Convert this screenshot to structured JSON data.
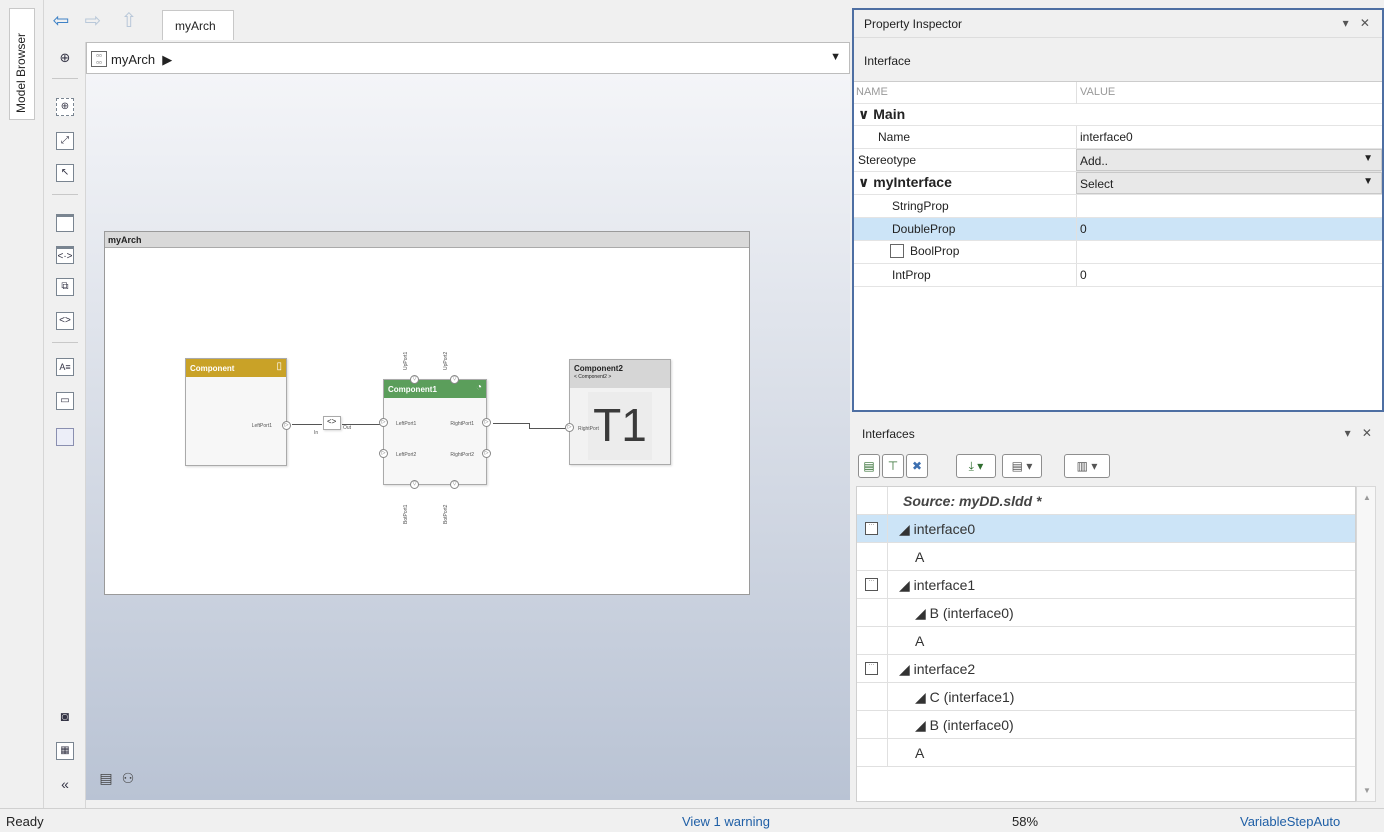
{
  "model_browser": {
    "label": "Model Browser"
  },
  "editor": {
    "tab_label": "myArch",
    "breadcrumb": "myArch",
    "canvas": {
      "architecture_title": "myArch",
      "component": {
        "name": "Component",
        "port_right": "LeftPort1"
      },
      "adapter": {
        "in_label": "In",
        "out_label": "Out"
      },
      "component1": {
        "name": "Component1",
        "ports_left": [
          "LeftPort1",
          "LeftPort2"
        ],
        "ports_right": [
          "RightPort1",
          "RightPort2"
        ],
        "ports_top": [
          "UpPort1",
          "UpPort2"
        ],
        "ports_bottom": [
          "BotPort1",
          "BotPort2"
        ]
      },
      "component2": {
        "name": "Component2",
        "subtitle": "< Component2 >",
        "port_left": "RightPort",
        "overlay_text": "T1"
      }
    }
  },
  "property_inspector": {
    "title": "Property Inspector",
    "pin_controls": "▾ ✕",
    "element_type": "Interface",
    "column_name": "NAME",
    "column_value": "VALUE",
    "sections": {
      "main": "Main",
      "my_interface": "myInterface"
    },
    "rows": {
      "name_label": "Name",
      "name_value": "interface0",
      "stereotype_label": "Stereotype",
      "stereotype_value": "Add..",
      "my_interface_value": "Select",
      "string_prop_label": "StringProp",
      "string_prop_value": "",
      "double_prop_label": "DoubleProp",
      "double_prop_value": "0",
      "bool_prop_label": "BoolProp",
      "int_prop_label": "IntProp",
      "int_prop_value": "0"
    }
  },
  "interfaces_pane": {
    "title": "Interfaces",
    "pin_controls": "▾ ✕",
    "source_header": "Source: myDD.sldd *",
    "items": [
      {
        "label": "◢ interface0",
        "depth": 0,
        "icon": true,
        "selected": true
      },
      {
        "label": "A",
        "depth": 1,
        "icon": false,
        "selected": false
      },
      {
        "label": "◢ interface1",
        "depth": 0,
        "icon": true,
        "selected": false
      },
      {
        "label": "◢ B (interface0)",
        "depth": 1,
        "icon": false,
        "selected": false
      },
      {
        "label": "A",
        "depth": 1,
        "icon": false,
        "selected": false
      },
      {
        "label": "◢ interface2",
        "depth": 0,
        "icon": true,
        "selected": false
      },
      {
        "label": "◢ C (interface1)",
        "depth": 1,
        "icon": false,
        "selected": false
      },
      {
        "label": "◢ B (interface0)",
        "depth": 1,
        "icon": false,
        "selected": false
      },
      {
        "label": "A",
        "depth": 1,
        "icon": false,
        "selected": false
      }
    ]
  },
  "status_bar": {
    "state": "Ready",
    "warning_link": "View 1 warning",
    "zoom": "58%",
    "solver": "VariableStepAuto"
  },
  "colors": {
    "accent": "#4e6fa3",
    "selection": "#cce4f7",
    "component_header": "#c9a227",
    "component1_header": "#5b9e5b",
    "link": "#1f5fa6"
  }
}
